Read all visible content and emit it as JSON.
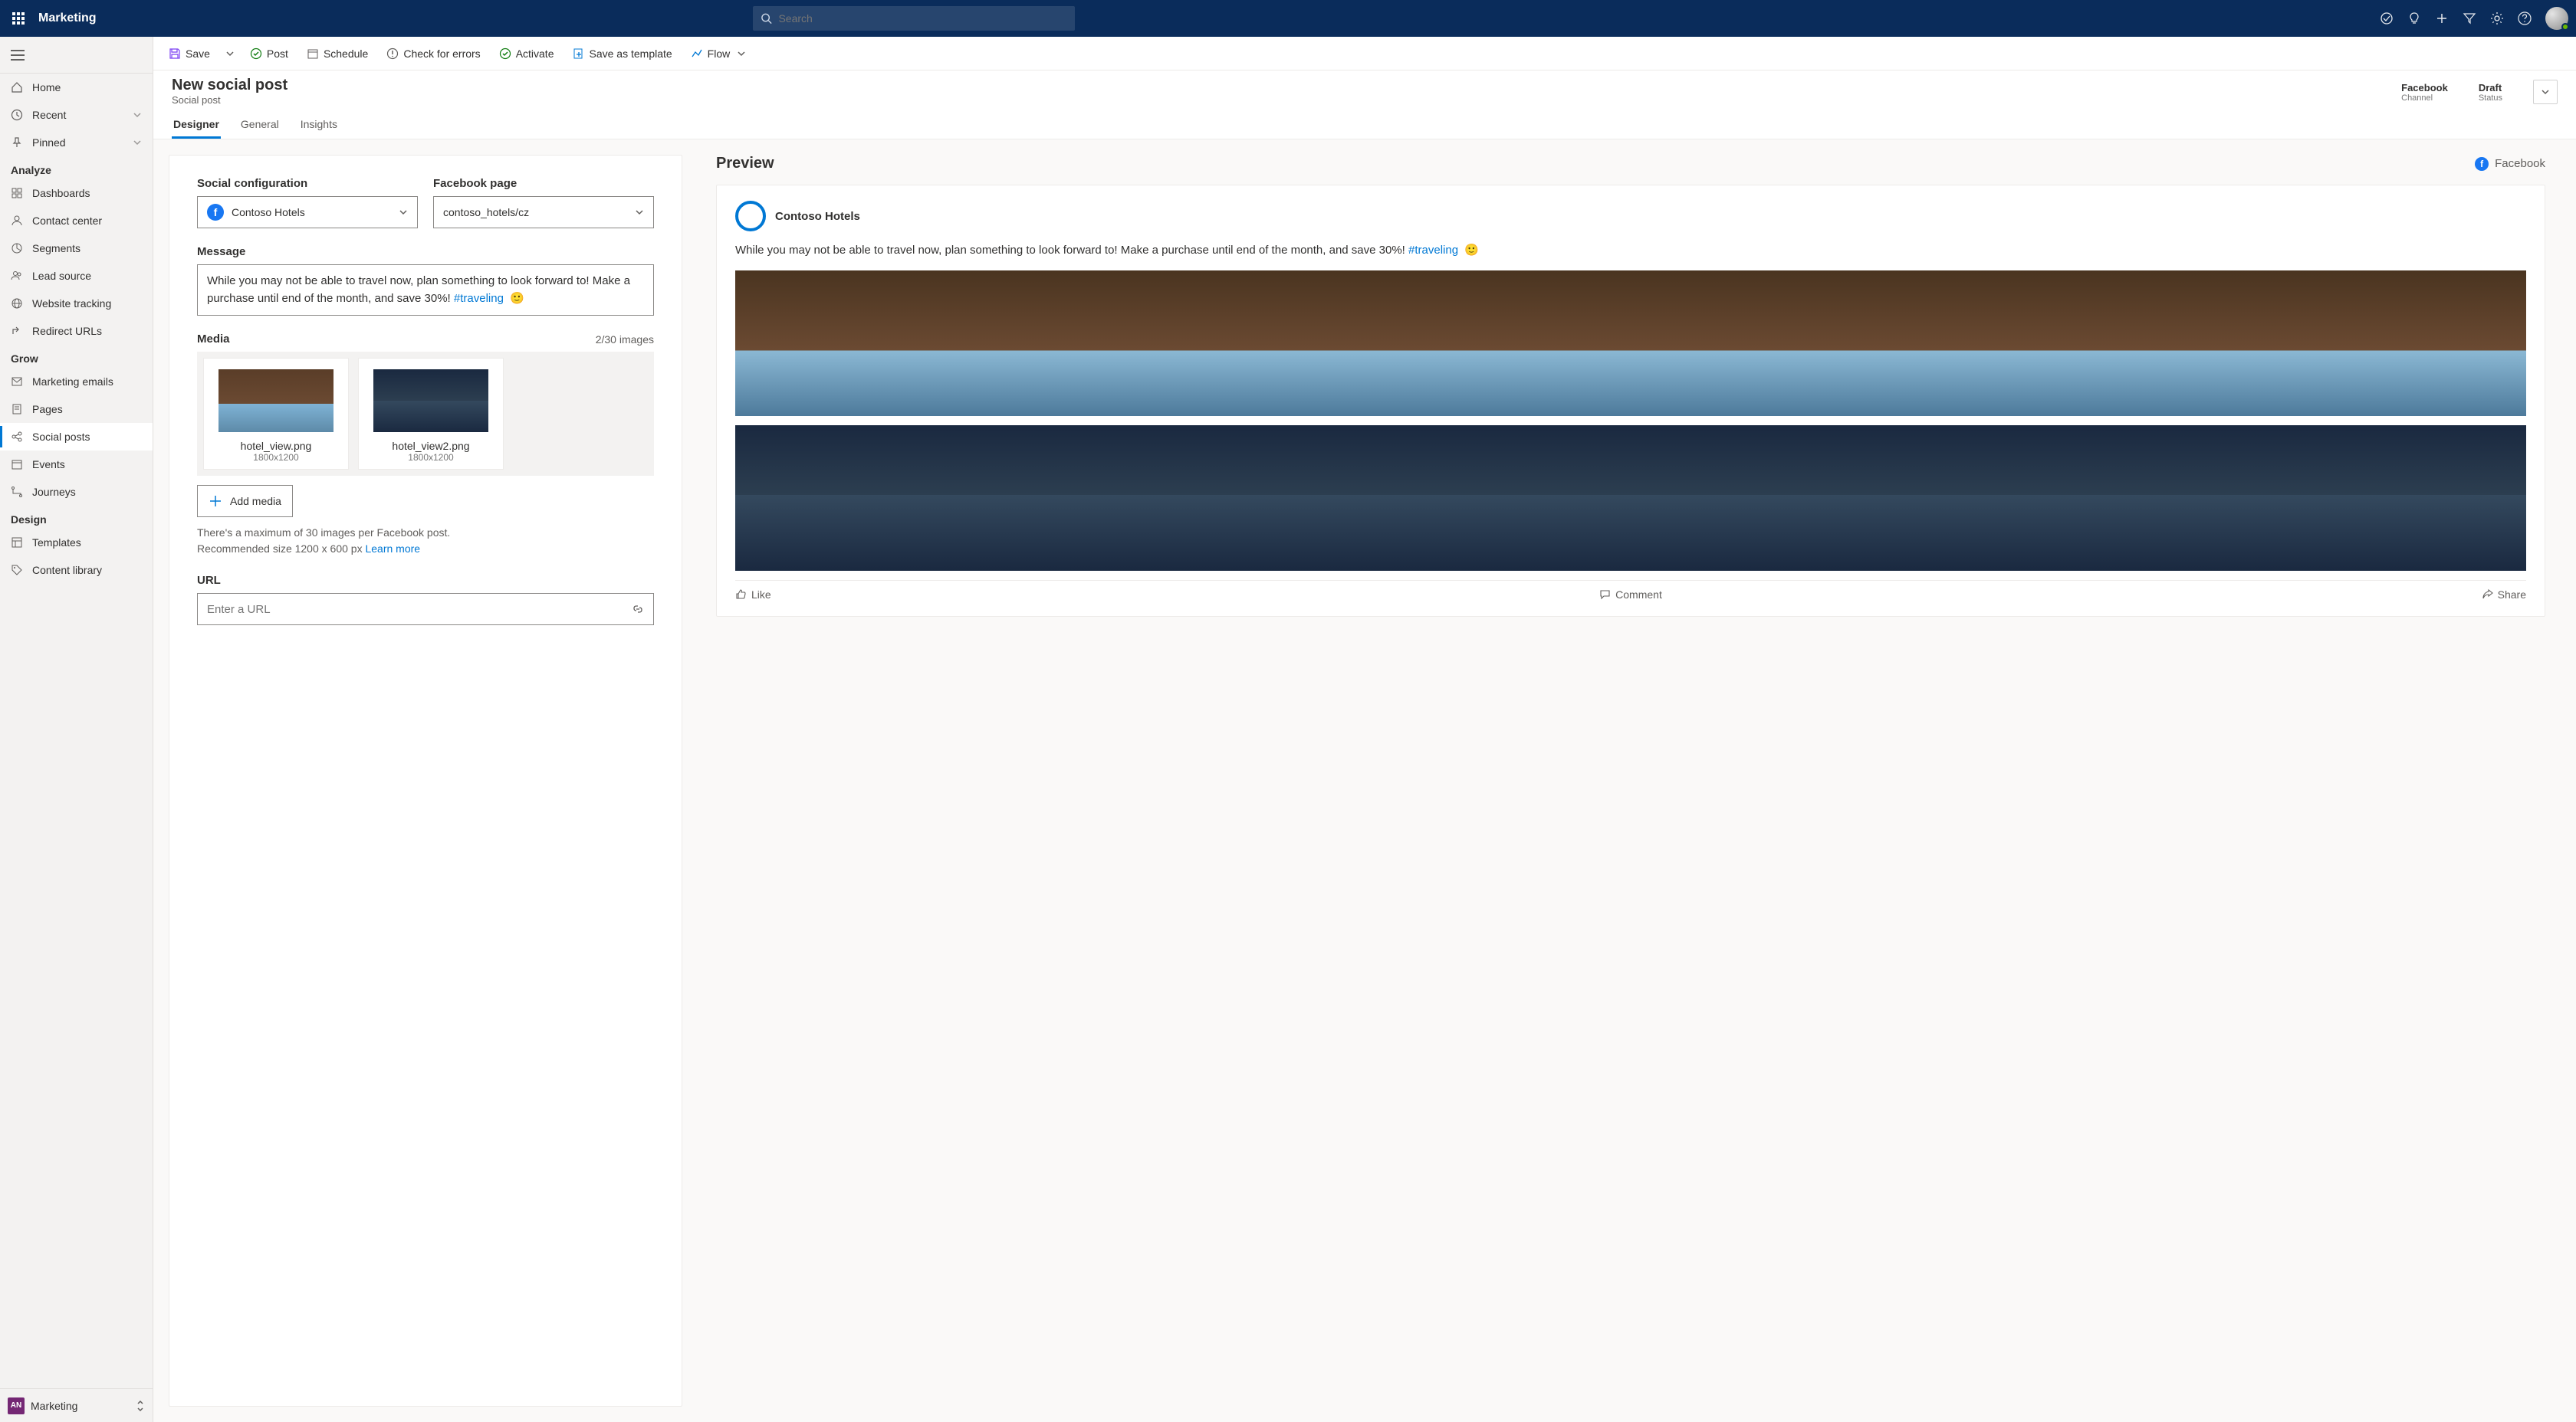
{
  "header": {
    "app_name": "Marketing",
    "search_placeholder": "Search"
  },
  "nav": {
    "home": "Home",
    "recent": "Recent",
    "pinned": "Pinned",
    "section_analyze": "Analyze",
    "analyze_items": [
      "Dashboards",
      "Contact center",
      "Segments",
      "Lead source",
      "Website tracking",
      "Redirect URLs"
    ],
    "section_grow": "Grow",
    "grow_items": [
      "Marketing emails",
      "Pages",
      "Social posts",
      "Events",
      "Journeys"
    ],
    "section_design": "Design",
    "design_items": [
      "Templates",
      "Content library"
    ],
    "footer_badge": "AN",
    "footer_label": "Marketing"
  },
  "toolbar": {
    "save": "Save",
    "post": "Post",
    "schedule": "Schedule",
    "check_errors": "Check for errors",
    "activate": "Activate",
    "save_template": "Save as template",
    "flow": "Flow"
  },
  "page": {
    "title": "New social post",
    "subtitle": "Social post",
    "channel_value": "Facebook",
    "channel_label": "Channel",
    "status_value": "Draft",
    "status_label": "Status"
  },
  "tabs": [
    "Designer",
    "General",
    "Insights"
  ],
  "form": {
    "social_config_label": "Social configuration",
    "social_config_value": "Contoso Hotels",
    "fb_page_label": "Facebook page",
    "fb_page_value": "contoso_hotels/cz",
    "message_label": "Message",
    "message_text": "While you may not be able to travel now, plan something to look forward to! Make a purchase until end of the month, and save 30%!",
    "message_hashtag": "#traveling",
    "media_label": "Media",
    "media_count": "2/30 images",
    "media_items": [
      {
        "name": "hotel_view.png",
        "dim": "1800x1200"
      },
      {
        "name": "hotel_view2.png",
        "dim": "1800x1200"
      }
    ],
    "add_media": "Add media",
    "help_line1": "There's a maximum of 30 images per Facebook post.",
    "help_line2": "Recommended size 1200 x 600 px ",
    "learn_more": "Learn more",
    "url_label": "URL",
    "url_placeholder": "Enter a URL"
  },
  "preview": {
    "title": "Preview",
    "channel": "Facebook",
    "brand": "Contoso Hotels",
    "text": "While you may not be able to travel now, plan something to look forward to! Make a purchase until end of the month, and save 30%!",
    "hashtag": "#traveling",
    "actions": {
      "like": "Like",
      "comment": "Comment",
      "share": "Share"
    }
  }
}
